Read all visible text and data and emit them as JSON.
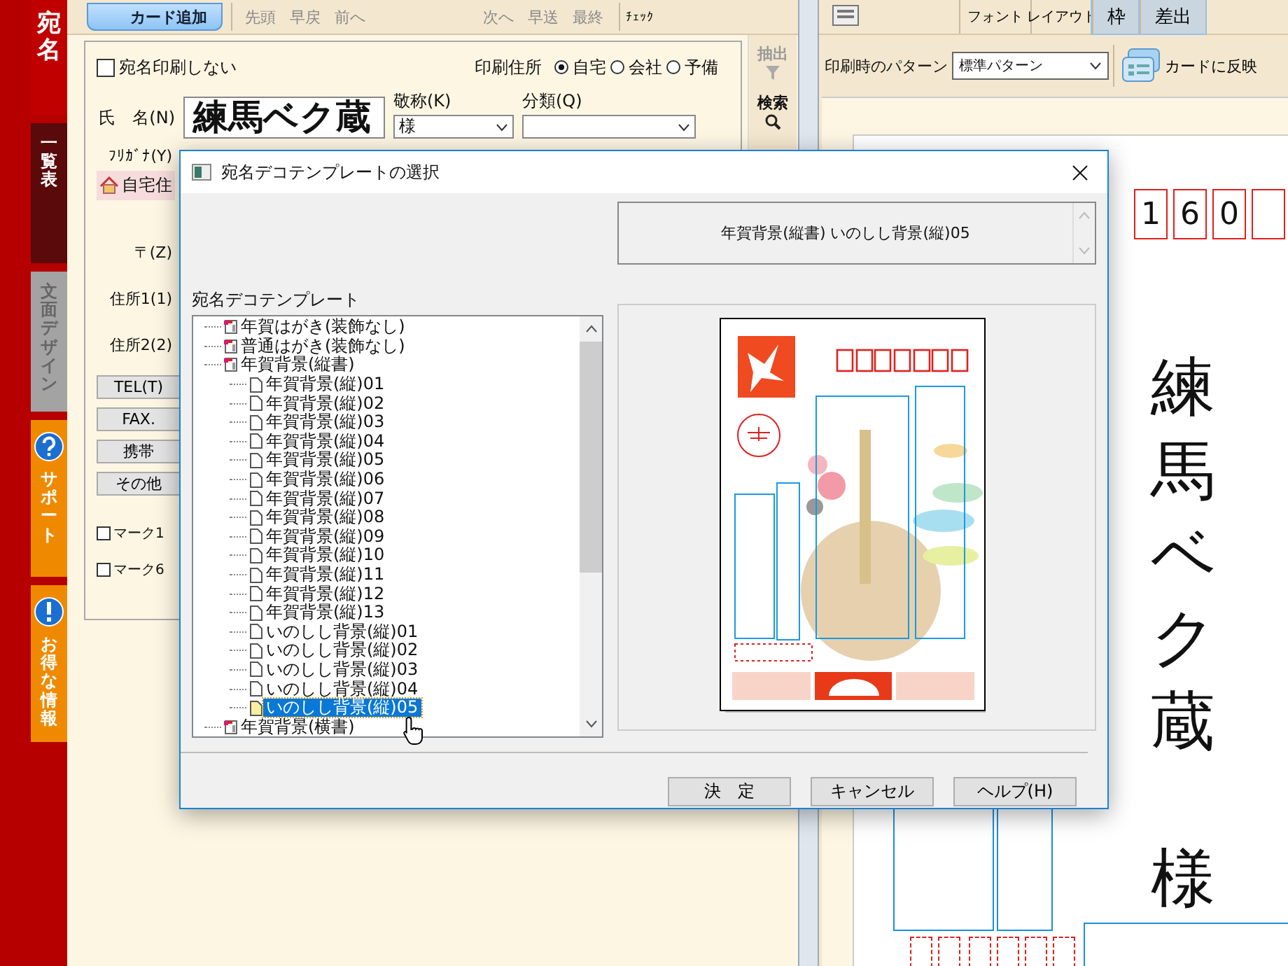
{
  "sidebar": {
    "tabs": [
      {
        "label": "宛名",
        "selected": true,
        "kind": "plain",
        "color": "#c00000"
      },
      {
        "label": "一覧表",
        "selected": false,
        "kind": "plain",
        "color": "#5a0a0a"
      },
      {
        "label": "文面デザイン",
        "selected": false,
        "kind": "plain",
        "color": "#a3a3a3"
      },
      {
        "label": "サポート",
        "selected": false,
        "kind": "help",
        "color": "#ef8a00"
      },
      {
        "label": "お得な情報",
        "selected": false,
        "kind": "info",
        "color": "#ef8a00"
      }
    ]
  },
  "toolbar": {
    "add_button": "カード追加",
    "nav": [
      {
        "label": "先頭",
        "disabled": true
      },
      {
        "label": "早戻",
        "disabled": true
      },
      {
        "label": "前へ",
        "disabled": true
      },
      {
        "label": "次へ",
        "disabled": true
      },
      {
        "label": "早送",
        "disabled": true
      },
      {
        "label": "最終",
        "disabled": true
      }
    ],
    "check": "ﾁｪｯｸ"
  },
  "form": {
    "no_print": {
      "label": "宛名印刷しない",
      "checked": false
    },
    "print_address": {
      "label": "印刷住所",
      "options": [
        {
          "label": "自宅",
          "selected": true
        },
        {
          "label": "会社",
          "selected": false
        },
        {
          "label": "予備",
          "selected": false
        }
      ]
    },
    "name": {
      "label": "氏　名(N)",
      "value": "練馬ベク蔵"
    },
    "honorific": {
      "label": "敬称(K)",
      "value": "様"
    },
    "category": {
      "label": "分類(Q)"
    },
    "furigana": {
      "label": "ﾌﾘｶﾞﾅ(Y)"
    },
    "address_tab": "自宅住",
    "postal": "〒(Z)",
    "address1": "住所1(1)",
    "address2": "住所2(2)",
    "contact_buttons": [
      "TEL(T)",
      "FAX.",
      "携帯",
      "その他"
    ],
    "marks": [
      {
        "label": "マーク1",
        "checked": false
      },
      {
        "label": "マーク6",
        "checked": false
      }
    ]
  },
  "side_tools": [
    {
      "label": "抽出",
      "disabled": true,
      "kind": "filter"
    },
    {
      "label": "検索",
      "disabled": false,
      "kind": "search"
    }
  ],
  "design_toolbar": {
    "tools": [
      {
        "label": "フォント",
        "selected": false
      },
      {
        "label": "レイアウト",
        "selected": false
      },
      {
        "label": "枠",
        "selected": true
      },
      {
        "label": "差出",
        "selected": true
      }
    ]
  },
  "pattern": {
    "label": "印刷時のパターン",
    "value": "標準パターン"
  },
  "apply_button": "カードに反映",
  "card": {
    "postal_digits": [
      "1",
      "6",
      "0"
    ],
    "name": "練馬ベク蔵",
    "honorific": "様"
  },
  "dialog": {
    "title": "宛名デコテンプレートの選択",
    "selection": "年賀背景(縦書) いのしし背景(縦)05",
    "tree_label": "宛名デコテンプレート",
    "tree": [
      {
        "label": "年賀はがき(装飾なし)",
        "kind": "folder",
        "selected": false
      },
      {
        "label": "普通はがき(装飾なし)",
        "kind": "folder",
        "selected": false
      },
      {
        "label": "年賀背景(縦書)",
        "kind": "folder",
        "selected": false,
        "children": [
          {
            "label": "年賀背景(縦)01",
            "kind": "file",
            "selected": false
          },
          {
            "label": "年賀背景(縦)02",
            "kind": "file",
            "selected": false
          },
          {
            "label": "年賀背景(縦)03",
            "kind": "file",
            "selected": false
          },
          {
            "label": "年賀背景(縦)04",
            "kind": "file",
            "selected": false
          },
          {
            "label": "年賀背景(縦)05",
            "kind": "file",
            "selected": false
          },
          {
            "label": "年賀背景(縦)06",
            "kind": "file",
            "selected": false
          },
          {
            "label": "年賀背景(縦)07",
            "kind": "file",
            "selected": false
          },
          {
            "label": "年賀背景(縦)08",
            "kind": "file",
            "selected": false
          },
          {
            "label": "年賀背景(縦)09",
            "kind": "file",
            "selected": false
          },
          {
            "label": "年賀背景(縦)10",
            "kind": "file",
            "selected": false
          },
          {
            "label": "年賀背景(縦)11",
            "kind": "file",
            "selected": false
          },
          {
            "label": "年賀背景(縦)12",
            "kind": "file",
            "selected": false
          },
          {
            "label": "年賀背景(縦)13",
            "kind": "file",
            "selected": false
          },
          {
            "label": "いのしし背景(縦)01",
            "kind": "file",
            "selected": false
          },
          {
            "label": "いのしし背景(縦)02",
            "kind": "file",
            "selected": false
          },
          {
            "label": "いのしし背景(縦)03",
            "kind": "file",
            "selected": false
          },
          {
            "label": "いのしし背景(縦)04",
            "kind": "file",
            "selected": false
          },
          {
            "label": "いのしし背景(縦)05",
            "kind": "file",
            "selected": true
          }
        ]
      },
      {
        "label": "年賀背景(横書)",
        "kind": "folder",
        "selected": false
      }
    ],
    "buttons": [
      "決　定",
      "キャンセル",
      "ヘルプ(H)"
    ]
  }
}
